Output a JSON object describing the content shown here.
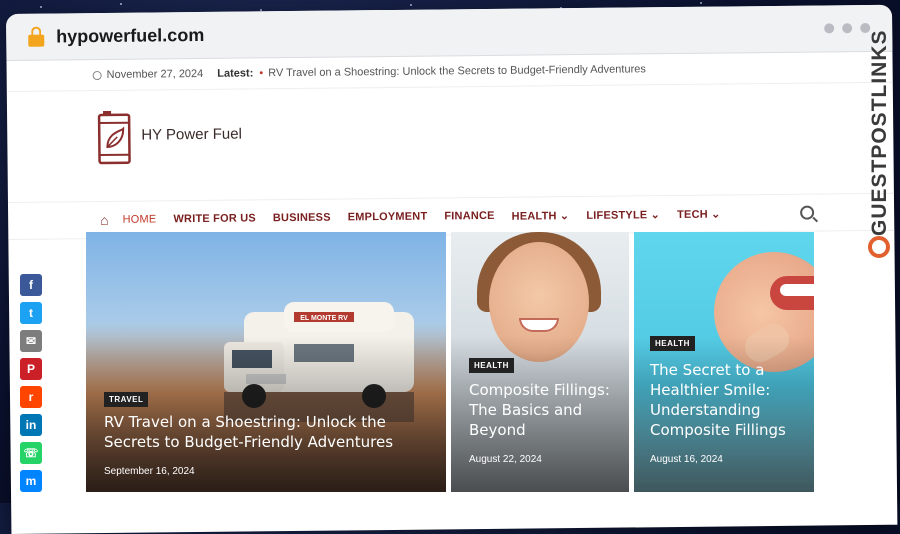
{
  "browser": {
    "url": "hypowerfuel.com"
  },
  "topbar": {
    "date": "November 27, 2024",
    "latest_label": "Latest:",
    "latest_headline": "RV Travel on a Shoestring: Unlock the Secrets to Budget-Friendly Adventures"
  },
  "site": {
    "name": "HY Power Fuel"
  },
  "nav": {
    "items": [
      {
        "label": "HOME"
      },
      {
        "label": "WRITE FOR US"
      },
      {
        "label": "BUSINESS"
      },
      {
        "label": "EMPLOYMENT"
      },
      {
        "label": "FINANCE"
      },
      {
        "label": "HEALTH ⌄"
      },
      {
        "label": "LIFESTYLE ⌄"
      },
      {
        "label": "TECH ⌄"
      }
    ]
  },
  "featured": [
    {
      "category": "TRAVEL",
      "title": "RV Travel on a Shoestring: Unlock the Secrets to Budget-Friendly Adventures",
      "date": "September 16, 2024"
    },
    {
      "category": "HEALTH",
      "title": "Composite Fillings: The Basics and Beyond",
      "date": "August 22, 2024"
    },
    {
      "category": "HEALTH",
      "title": "The Secret to a Healthier Smile: Understanding Composite Fillings",
      "date": "August 16, 2024"
    }
  ],
  "rv_sign": "EL MONTE RV",
  "social": [
    {
      "name": "facebook",
      "glyph": "f",
      "color": "#3b5998"
    },
    {
      "name": "twitter",
      "glyph": "t",
      "color": "#1da1f2"
    },
    {
      "name": "email",
      "glyph": "✉",
      "color": "#7d7d7d"
    },
    {
      "name": "pinterest",
      "glyph": "P",
      "color": "#cb2027"
    },
    {
      "name": "reddit",
      "glyph": "r",
      "color": "#ff4500"
    },
    {
      "name": "linkedin",
      "glyph": "in",
      "color": "#0077b5"
    },
    {
      "name": "whatsapp",
      "glyph": "☏",
      "color": "#25d366"
    },
    {
      "name": "messenger",
      "glyph": "m",
      "color": "#0084ff"
    }
  ],
  "watermark": "GUESTPOSTLINKS"
}
